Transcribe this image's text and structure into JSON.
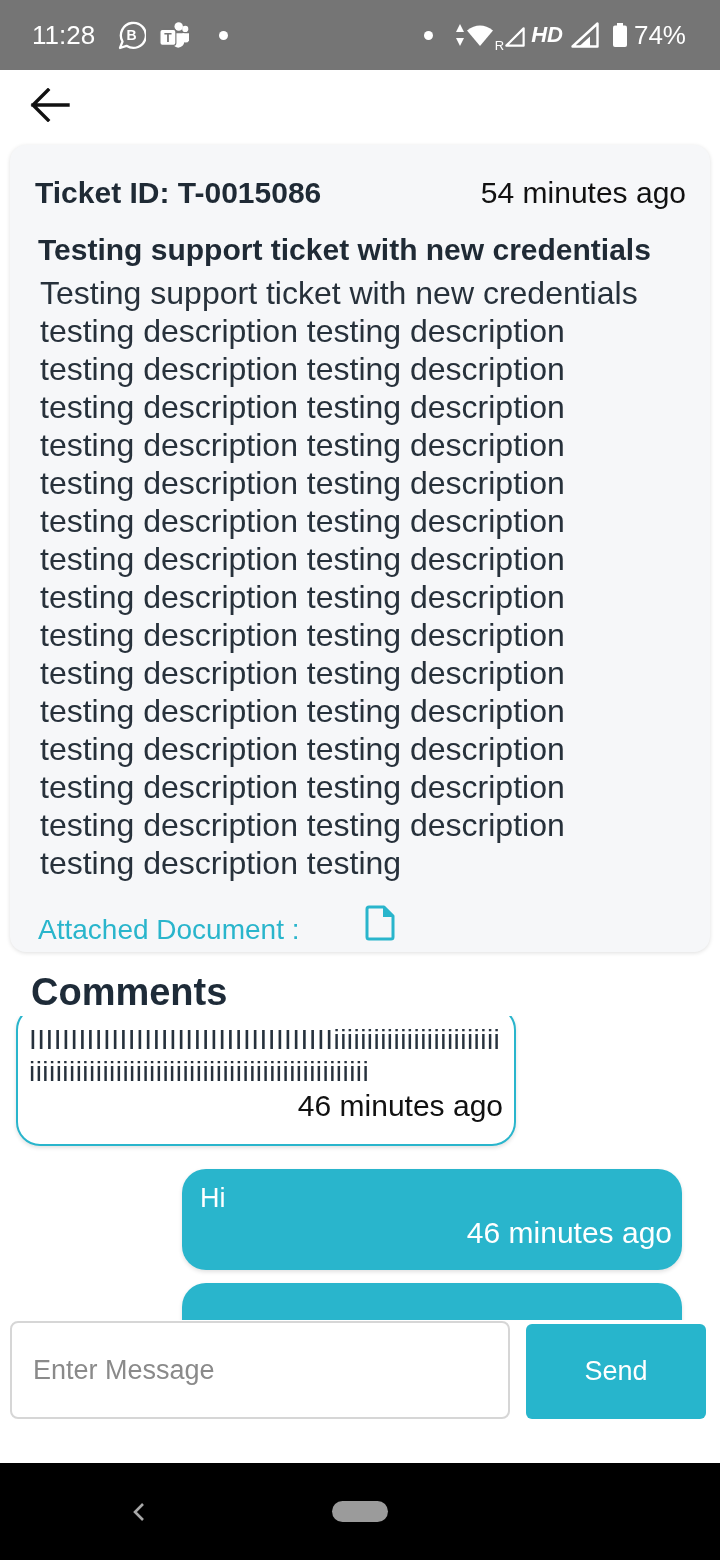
{
  "status_bar": {
    "time": "11:28",
    "notifications": [
      {
        "kind": "business-chat",
        "letter": "B"
      },
      {
        "kind": "teams",
        "letter": "T"
      }
    ],
    "roaming": "R",
    "network": "HD",
    "battery": "74%"
  },
  "ticket": {
    "id_label": "Ticket ID: T-0015086",
    "age": "54 minutes ago",
    "title": "Testing support ticket with new credentials",
    "description": "Testing support ticket with new credentials testing description testing description testing description testing description testing description testing description testing description testing description testing description testing description testing description testing description testing description testing description testing description testing description testing description testing description testing description testing description testing description testing description testing description testing description testing description testing description testing description testing description testing description testing",
    "attachment_label": "Attached Document :"
  },
  "comments": {
    "heading": "Comments",
    "messages": [
      {
        "kind": "received",
        "text": "IIIIIIIIIIIIIIIIIIIIIIIIIIIIIIIIIIIIIiiiiiiiiiiiiiiiiiiiiiiiiiiiiiiiiiiiiiiiiiiiiiiiiiiiiiiiiiiiiiiiiiiiiiiiiiiii",
        "time": "46 minutes ago"
      },
      {
        "kind": "sent",
        "text": "Hi",
        "time": "46 minutes ago"
      },
      {
        "kind": "sent"
      }
    ]
  },
  "composer": {
    "placeholder": "Enter Message",
    "send_label": "Send"
  }
}
